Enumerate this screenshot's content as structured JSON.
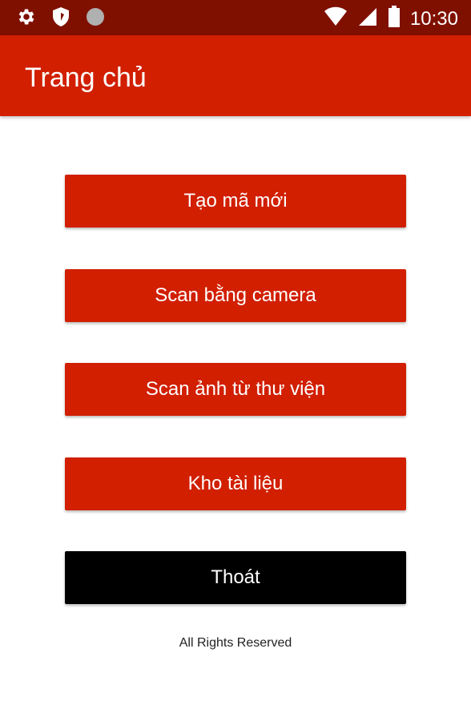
{
  "status_bar": {
    "time": "10:30",
    "left_icons": [
      "gear-icon",
      "shield-icon",
      "circle-icon"
    ],
    "right_icons": [
      "wifi-icon",
      "signal-icon",
      "battery-icon"
    ]
  },
  "app_bar": {
    "title": "Trang chủ"
  },
  "menu": {
    "create_new": "Tạo mã mới",
    "scan_camera": "Scan bằng camera",
    "scan_gallery": "Scan ảnh từ thư viện",
    "documents": "Kho tài liệu",
    "exit": "Thoát"
  },
  "footer": {
    "text": "All Rights Reserved"
  },
  "colors": {
    "status_bar": "#7f1000",
    "primary": "#d11f00",
    "exit_button": "#000000",
    "background": "#ffffff"
  }
}
